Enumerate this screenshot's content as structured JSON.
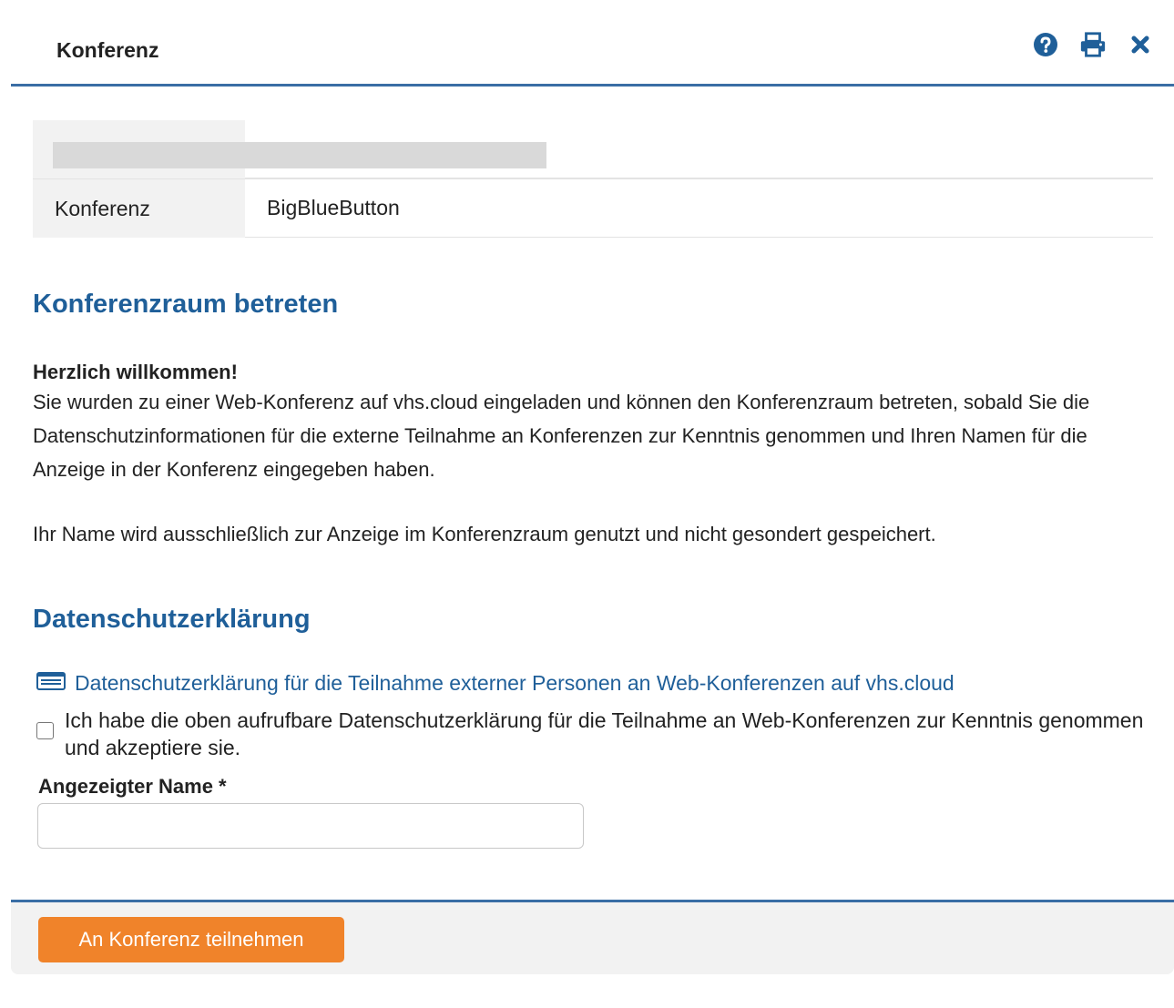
{
  "header": {
    "title": "Konferenz",
    "icons": [
      "help-icon",
      "print-icon",
      "close-icon"
    ]
  },
  "info_table": {
    "rows": [
      {
        "label": "",
        "value": ""
      },
      {
        "label": "Konferenz",
        "value": "BigBlueButton"
      }
    ]
  },
  "section_join": {
    "heading": "Konferenzraum betreten",
    "welcome": "Herzlich willkommen!",
    "paragraph1": "Sie wurden zu einer Web-Konferenz auf vhs.cloud eingeladen und können den Konferenzraum betreten, sobald Sie die Datenschutzinformationen für die externe Teilnahme an Konferenzen zur Kenntnis genommen und Ihren Namen für die Anzeige in der Konferenz eingegeben haben.",
    "paragraph2": "Ihr Name wird ausschließlich zur Anzeige im Konferenzraum genutzt und nicht gesondert gespeichert."
  },
  "section_privacy": {
    "heading": "Datenschutzerklärung",
    "link_text": "Datenschutzerklärung für die Teilnahme externer Personen an Web-Konferenzen auf vhs.cloud",
    "consent_text": "Ich habe die oben aufrufbare Datenschutzerklärung für die Teilnahme an Web-Konferenzen zur Kenntnis genommen und akzeptiere sie.",
    "consent_checked": false
  },
  "name_field": {
    "label": "Angezeigter Name *",
    "value": "",
    "placeholder": ""
  },
  "footer": {
    "join_button_label": "An Konferenz teilnehmen"
  },
  "colors": {
    "accent_blue": "#1f5f99",
    "rule_blue": "#3a6ea5",
    "button_orange": "#f0832a",
    "table_label_bg": "#f2f2f2"
  }
}
